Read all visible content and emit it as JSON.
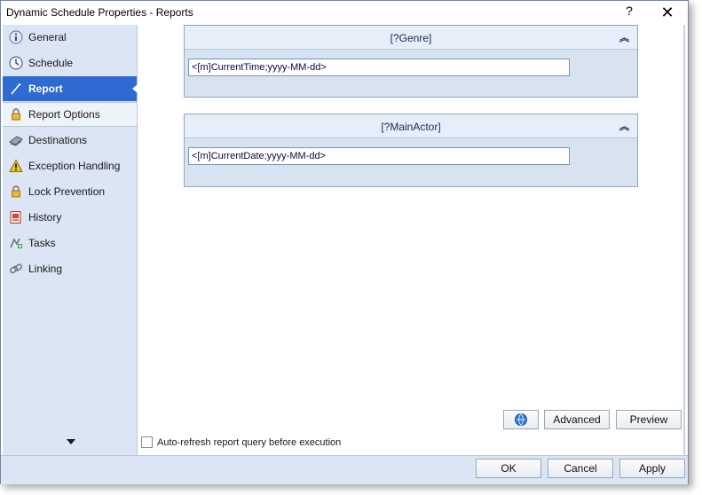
{
  "window": {
    "title": "Dynamic Schedule Properties - Reports",
    "help_label": "?",
    "close_label": "✕"
  },
  "sidebar": {
    "items": [
      {
        "id": "general",
        "label": "General",
        "icon": "info-icon"
      },
      {
        "id": "schedule",
        "label": "Schedule",
        "icon": "clock-icon"
      },
      {
        "id": "report",
        "label": "Report",
        "icon": "report-icon",
        "active": true
      },
      {
        "id": "report-options",
        "label": "Report Options",
        "icon": "lock-options-icon"
      },
      {
        "id": "destinations",
        "label": "Destinations",
        "icon": "destinations-icon"
      },
      {
        "id": "exception-handling",
        "label": "Exception Handling",
        "icon": "warning-icon"
      },
      {
        "id": "lock-prevention",
        "label": "Lock Prevention",
        "icon": "lock-icon"
      },
      {
        "id": "history",
        "label": "History",
        "icon": "history-icon"
      },
      {
        "id": "tasks",
        "label": "Tasks",
        "icon": "tasks-icon"
      },
      {
        "id": "linking",
        "label": "Linking",
        "icon": "link-icon"
      }
    ]
  },
  "parameters": [
    {
      "name": "[?Genre]",
      "value": "<[m]CurrentTime;yyyy-MM-dd>"
    },
    {
      "name": "[?MainActor]",
      "value": "<[m]CurrentDate;yyyy-MM-dd>"
    }
  ],
  "actions": {
    "advanced_label": "Advanced",
    "preview_label": "Preview"
  },
  "auto_refresh": {
    "label": "Auto-refresh report query before execution",
    "checked": false
  },
  "footer": {
    "ok_label": "OK",
    "cancel_label": "Cancel",
    "apply_label": "Apply"
  },
  "colors": {
    "active_nav": "#2d6bd1",
    "sidebar_bg": "#dbe5f3",
    "group_bg": "#d8e3f2"
  }
}
